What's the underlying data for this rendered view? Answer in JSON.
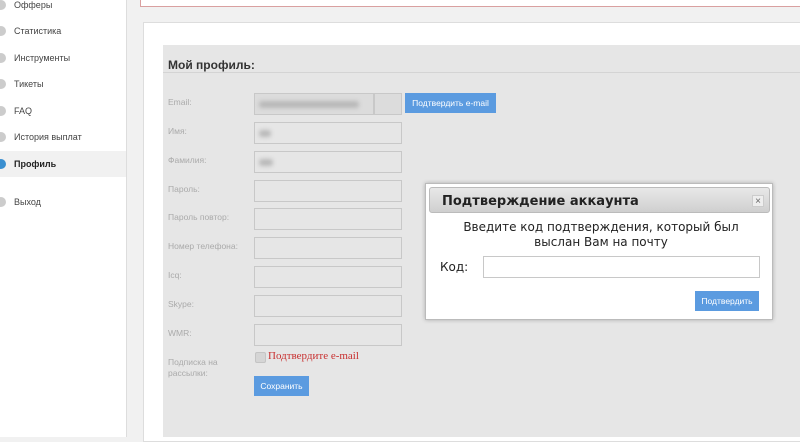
{
  "sidebar": {
    "items": [
      {
        "label": "Офферы"
      },
      {
        "label": "Статистика"
      },
      {
        "label": "Инструменты"
      },
      {
        "label": "Тикеты"
      },
      {
        "label": "FAQ"
      },
      {
        "label": "История выплат"
      },
      {
        "label": "Профиль",
        "active": true
      },
      {
        "label": "Выход"
      }
    ]
  },
  "profile": {
    "title": "Мой профиль:",
    "fields": [
      {
        "label": "Email:"
      },
      {
        "label": "Имя:"
      },
      {
        "label": "Фамилия:"
      },
      {
        "label": "Пароль:"
      },
      {
        "label": "Пароль повтор:"
      },
      {
        "label": "Номер телефона:"
      },
      {
        "label": "Icq:"
      },
      {
        "label": "Skype:"
      },
      {
        "label": "WMR:"
      }
    ],
    "confirm_email_button": "Подтвердить e-mail",
    "subscription_label": "Подписка на рассылки:",
    "subscription_note": "Подтвердите e-mail",
    "save_button": "Сохранить"
  },
  "modal": {
    "title": "Подтверждение аккаунта",
    "close": "×",
    "message": "Введите код подтверждения, который был выслан Вам на почту",
    "code_label": "Код:",
    "code_value": "",
    "submit": "Подтвердить"
  },
  "colors": {
    "accent": "#5b9be0",
    "error": "#c83030"
  }
}
